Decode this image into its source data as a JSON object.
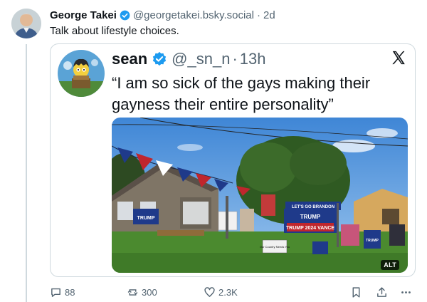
{
  "post": {
    "author_name": "George Takei",
    "handle": "@georgetakei.bsky.social",
    "separator": "·",
    "time": "2d",
    "text": "Talk about lifestyle choices."
  },
  "quoted": {
    "author_name": "sean",
    "handle": "@_sn_n",
    "separator": "·",
    "time": "13h",
    "text": "“I am so sick of the gays making their gayness their entire personality”",
    "platform_icon": "x-logo-icon",
    "photo": {
      "alt_badge": "ALT",
      "signs": [
        "TRUMP",
        "TRUMP",
        "TRUMP 2024 VANCE",
        "Our Country Needs You",
        "TRUMP",
        "LET'S GO BRANDON"
      ]
    }
  },
  "actions": {
    "replies": "88",
    "reposts": "300",
    "likes": "2.3K"
  },
  "colors": {
    "text": "#0f1419",
    "muted": "#536471",
    "border": "#cfd9de",
    "verified": "#1d9bf0"
  }
}
